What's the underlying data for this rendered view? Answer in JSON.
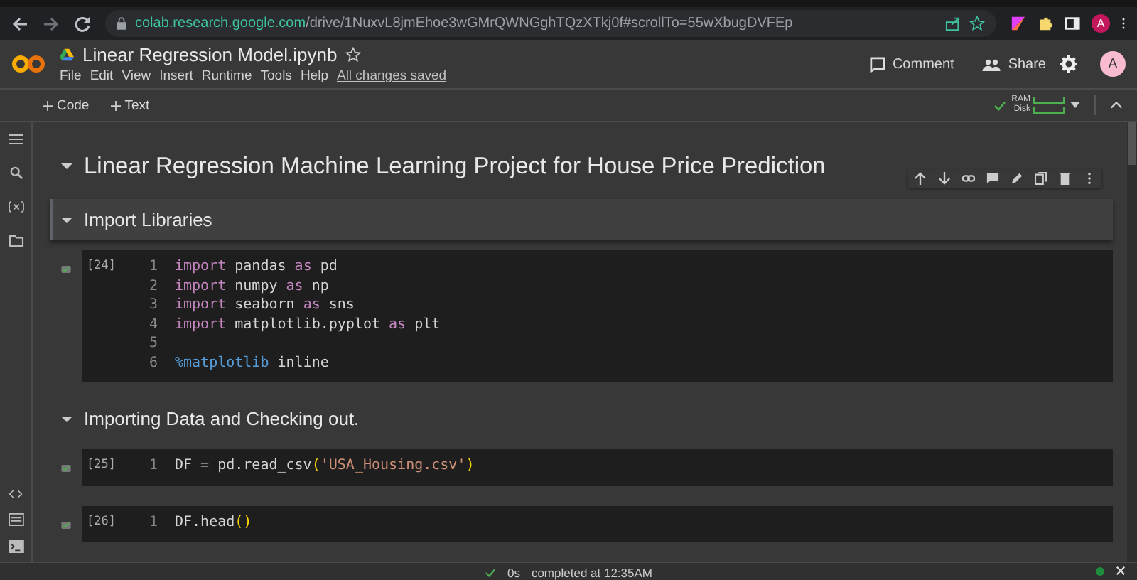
{
  "browser": {
    "url_host": "colab.research.google.com",
    "url_path": "/drive/1NuxvL8jmEhoe3wGMrQWNGghTQzXTkj0f#scrollTo=55wXbugDVFEp",
    "profile_initial": "A"
  },
  "header": {
    "title": "Linear Regression Model.ipynb",
    "starred": false,
    "menu": [
      "File",
      "Edit",
      "View",
      "Insert",
      "Runtime",
      "Tools",
      "Help"
    ],
    "save_status": "All changes saved",
    "comment": "Comment",
    "share": "Share",
    "avatar_initial": "A"
  },
  "toolbar": {
    "add_buttons": [
      "Code",
      "Text"
    ],
    "ram_label": "RAM",
    "disk_label": "Disk",
    "connected": true
  },
  "cells": [
    {
      "kind": "title",
      "text": "Linear Regression Machine Learning Project for House Price Prediction",
      "expanded": true,
      "selected": false
    },
    {
      "kind": "section",
      "text": "Import Libraries",
      "expanded": true,
      "selected": true
    },
    {
      "kind": "code",
      "execution_count": "[24]",
      "selected": false,
      "lines": [
        {
          "number": "1",
          "tokens": [
            {
              "kind": "keyword",
              "text": "import"
            },
            {
              "kind": "plain",
              "text": " pandas "
            },
            {
              "kind": "keyword",
              "text": "as"
            },
            {
              "kind": "plain",
              "text": " pd"
            }
          ]
        },
        {
          "number": "2",
          "tokens": [
            {
              "kind": "keyword",
              "text": "import"
            },
            {
              "kind": "plain",
              "text": " numpy "
            },
            {
              "kind": "keyword",
              "text": "as"
            },
            {
              "kind": "plain",
              "text": " np"
            }
          ]
        },
        {
          "number": "3",
          "tokens": [
            {
              "kind": "keyword",
              "text": "import"
            },
            {
              "kind": "plain",
              "text": " seaborn "
            },
            {
              "kind": "keyword",
              "text": "as"
            },
            {
              "kind": "plain",
              "text": " sns"
            }
          ]
        },
        {
          "number": "4",
          "tokens": [
            {
              "kind": "keyword",
              "text": "import"
            },
            {
              "kind": "plain",
              "text": " matplotlib.pyplot "
            },
            {
              "kind": "keyword",
              "text": "as"
            },
            {
              "kind": "plain",
              "text": " plt"
            }
          ]
        },
        {
          "number": "5"
        },
        {
          "number": "6",
          "tokens": [
            {
              "kind": "magic",
              "text": "%matplotlib"
            },
            {
              "kind": "plain",
              "text": " inline"
            }
          ]
        }
      ]
    },
    {
      "kind": "section",
      "text": "Importing Data and Checking out.",
      "expanded": true,
      "selected": false
    },
    {
      "kind": "code",
      "execution_count": "[25]",
      "selected": false,
      "lines": [
        {
          "number": "1",
          "tokens": [
            {
              "kind": "plain",
              "text": "DF = pd.read_csv"
            },
            {
              "kind": "paren",
              "text": "("
            },
            {
              "kind": "string",
              "text": "'USA_Housing.csv'"
            },
            {
              "kind": "paren",
              "text": ")"
            }
          ]
        }
      ]
    },
    {
      "kind": "code",
      "execution_count": "[26]",
      "selected": false,
      "lines": [
        {
          "number": "1",
          "tokens": [
            {
              "kind": "plain",
              "text": "DF.head"
            },
            {
              "kind": "paren",
              "text": "()"
            }
          ]
        }
      ]
    }
  ],
  "status_bar": {
    "duration": "0s",
    "message": "completed at 12:35AM"
  }
}
